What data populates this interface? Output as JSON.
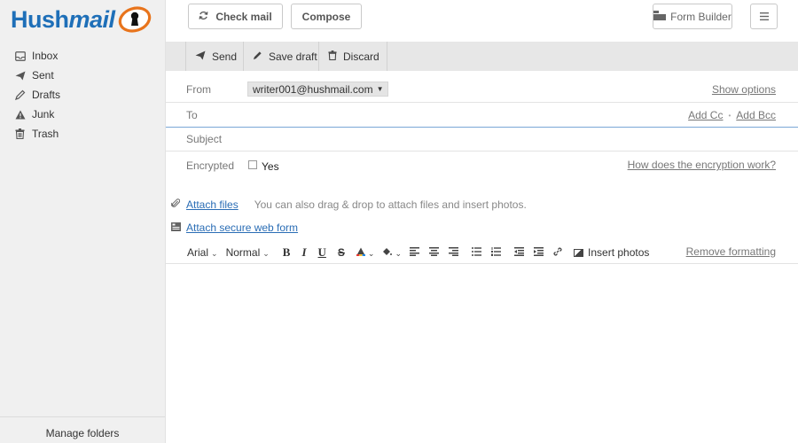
{
  "app": {
    "logo_text_bold": "Hush",
    "logo_text_italic": "mail"
  },
  "sidebar": {
    "folders": [
      {
        "label": "Inbox",
        "icon": "inbox-icon"
      },
      {
        "label": "Sent",
        "icon": "paper-plane-icon"
      },
      {
        "label": "Drafts",
        "icon": "pencil-icon"
      },
      {
        "label": "Junk",
        "icon": "warning-icon"
      },
      {
        "label": "Trash",
        "icon": "trash-icon"
      }
    ],
    "manage_label": "Manage folders"
  },
  "topbar": {
    "check_mail": "Check mail",
    "compose": "Compose",
    "form_builder": "Form Builder"
  },
  "actions": {
    "send": "Send",
    "save_draft": "Save draft",
    "discard": "Discard"
  },
  "compose": {
    "from_label": "From",
    "from_value": "writer001@hushmail.com",
    "show_options": "Show options",
    "to_label": "To",
    "add_cc": "Add Cc",
    "separator": "•",
    "add_bcc": "Add Bcc",
    "subject_label": "Subject",
    "encrypted_label": "Encrypted",
    "encrypted_yes": "Yes",
    "encryption_link": "How does the encryption work?"
  },
  "attach": {
    "files_link": "Attach files",
    "hint": "You can also drag & drop to attach files and insert photos.",
    "web_form_link": "Attach secure web form"
  },
  "toolbar": {
    "font": "Arial",
    "size": "Normal",
    "bold": "B",
    "italic": "I",
    "underline": "U",
    "strike": "S",
    "insert_photos": "Insert photos",
    "remove_formatting": "Remove formatting"
  },
  "colors": {
    "brand_blue": "#1e6fb8",
    "brand_orange": "#e8741c",
    "link_blue": "#2a6db5"
  }
}
